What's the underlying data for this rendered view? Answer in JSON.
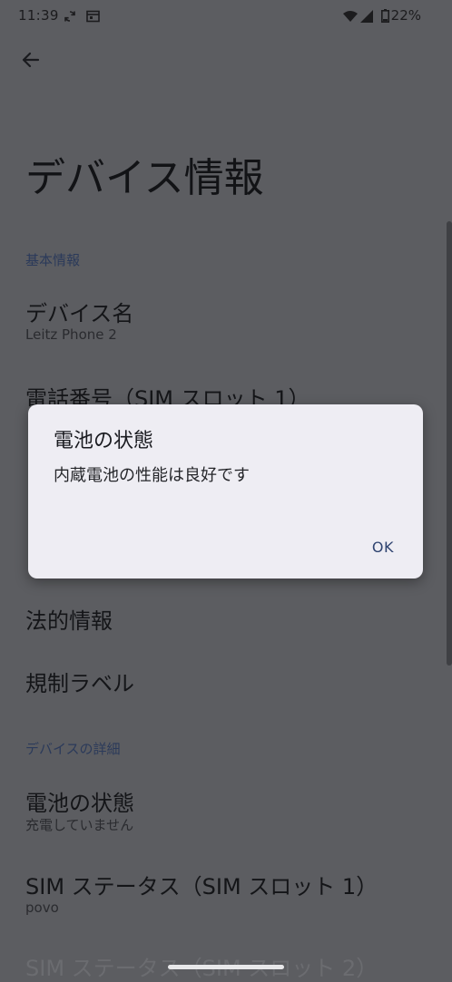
{
  "status_bar": {
    "time": "11:39",
    "battery_pct": "22%"
  },
  "page": {
    "title": "デバイス情報"
  },
  "sections": {
    "basic": "基本情報",
    "details": "デバイスの詳細"
  },
  "items": {
    "device_name": {
      "title": "デバイス名",
      "sub": "Leitz Phone 2"
    },
    "phone_number": {
      "title": "電話番号（SIM スロット 1）"
    },
    "legal": {
      "title": "法的情報"
    },
    "regulatory": {
      "title": "規制ラベル"
    },
    "battery": {
      "title": "電池の状態",
      "sub": "充電していません"
    },
    "sim1": {
      "title": "SIM ステータス（SIM スロット 1）",
      "sub": "povo"
    },
    "sim2": {
      "title": "SIM ステータス（SIM スロット 2）"
    }
  },
  "dialog": {
    "title": "電池の状態",
    "message": "内蔵電池の性能は良好です",
    "ok": "OK"
  }
}
